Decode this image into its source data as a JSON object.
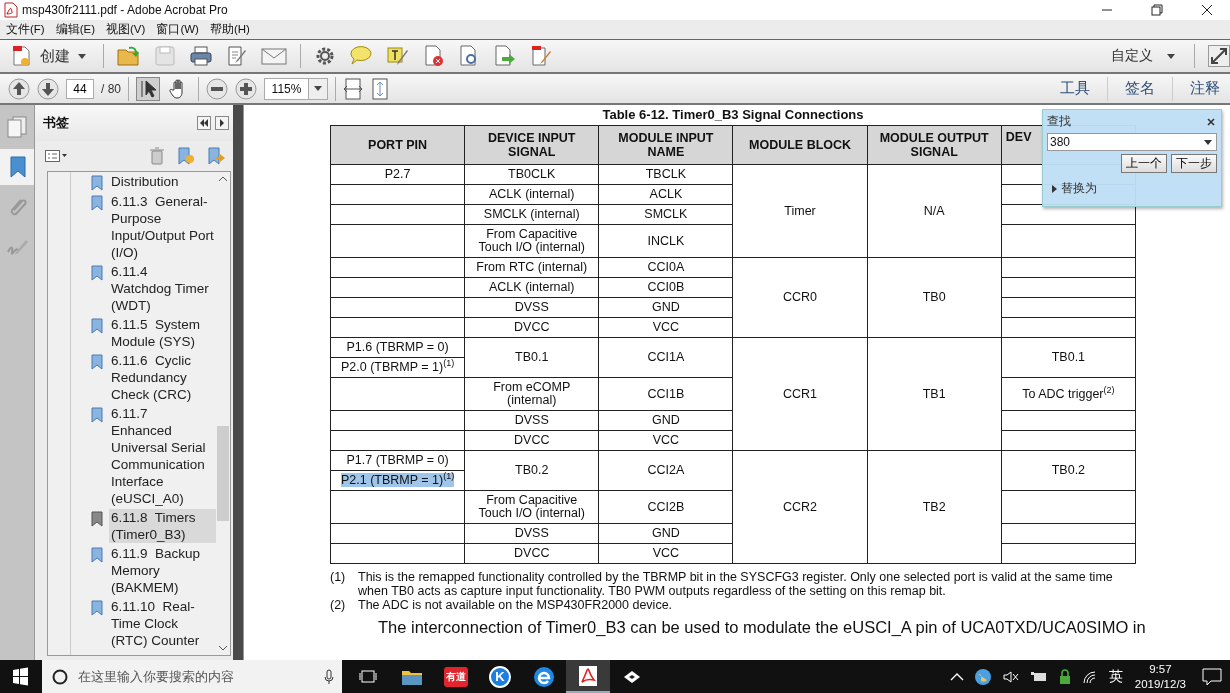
{
  "window": {
    "title": "msp430fr2111.pdf - Adobe Acrobat Pro"
  },
  "menu": [
    "文件(F)",
    "编辑(E)",
    "视图(V)",
    "窗口(W)",
    "帮助(H)"
  ],
  "toolbar": {
    "create_label": "创建",
    "save_disabled": true,
    "customize_label": "自定义"
  },
  "nav_toolbar": {
    "page": "44",
    "page_count": "/ 80",
    "select_tool_selected": true,
    "hand_tool_selected": false,
    "zoom": "115%"
  },
  "panes": [
    "工具",
    "签名",
    "注释"
  ],
  "sidebar": {
    "title": "书签",
    "bookmarks": [
      {
        "label": "Distribution",
        "selected": false
      },
      {
        "label": "6.11.3  General-Purpose Input/Output Port (I/O)",
        "selected": false
      },
      {
        "label": "6.11.4  Watchdog Timer (WDT)",
        "selected": false
      },
      {
        "label": "6.11.5  System Module (SYS)",
        "selected": false
      },
      {
        "label": "6.11.6  Cyclic Redundancy Check (CRC)",
        "selected": false
      },
      {
        "label": "6.11.7  Enhanced Universal Serial Communication Interface (eUSCI_A0)",
        "selected": false
      },
      {
        "label": "6.11.8  Timers (Timer0_B3)",
        "selected": true
      },
      {
        "label": "6.11.9  Backup Memory (BAKMEM)",
        "selected": false
      },
      {
        "label": "6.11.10  Real-Time Clock (RTC) Counter",
        "selected": false
      }
    ]
  },
  "document": {
    "table_title": "Table 6-12. Timer0_B3 Signal Connections",
    "table": {
      "columns": [
        "PORT PIN",
        "DEVICE INPUT SIGNAL",
        "MODULE INPUT NAME",
        "MODULE BLOCK",
        "MODULE OUTPUT SIGNAL",
        "DEV"
      ],
      "groups": [
        {
          "module_block": "Timer",
          "module_output": "N/A",
          "rows": [
            {
              "port_pins": [
                {
                  "text": "P2.7",
                  "highlighted": false
                }
              ],
              "device_input": "TB0CLK",
              "module_input": "TBCLK"
            },
            {
              "device_input": "ACLK (internal)",
              "module_input": "ACLK"
            },
            {
              "device_input": "SMCLK (internal)",
              "module_input": "SMCLK"
            },
            {
              "device_input": "From Capacitive Touch I/O (internal)",
              "module_input": "INCLK"
            }
          ]
        },
        {
          "module_block": "CCR0",
          "module_output": "TB0",
          "rows": [
            {
              "device_input": "From RTC (internal)",
              "module_input": "CCI0A"
            },
            {
              "device_input": "ACLK (internal)",
              "module_input": "CCI0B"
            },
            {
              "device_input": "DVSS",
              "module_input": "GND"
            },
            {
              "device_input": "DVCC",
              "module_input": "VCC"
            }
          ]
        },
        {
          "module_block": "CCR1",
          "module_output": "TB1",
          "rows": [
            {
              "port_pins": [
                {
                  "text": "P1.6 (TBRMP = 0)",
                  "highlighted": false
                },
                {
                  "text": "P2.0 (TBRMP = 1)$^{(1)}$",
                  "highlighted": false
                }
              ],
              "device_input": "TB0.1",
              "module_input": "CCI1A",
              "device_output": "TB0.1"
            },
            {
              "device_input": "From eCOMP (internal)",
              "module_input": "CCI1B",
              "device_output": "To ADC trigger$^{(2)}$"
            },
            {
              "device_input": "DVSS",
              "module_input": "GND"
            },
            {
              "device_input": "DVCC",
              "module_input": "VCC"
            }
          ]
        },
        {
          "module_block": "CCR2",
          "module_output": "TB2",
          "rows": [
            {
              "port_pins": [
                {
                  "text": "P1.7 (TBRMP = 0)",
                  "highlighted": false
                },
                {
                  "text": "P2.1 (TBRMP = 1)$^{(1)}$",
                  "highlighted": true
                }
              ],
              "device_input": "TB0.2",
              "module_input": "CCI2A",
              "device_output": "TB0.2"
            },
            {
              "device_input": "From Capacitive Touch I/O (internal)",
              "module_input": "CCI2B"
            },
            {
              "device_input": "DVSS",
              "module_input": "GND"
            },
            {
              "device_input": "DVCC",
              "module_input": "VCC"
            }
          ]
        }
      ]
    },
    "footnotes": [
      {
        "mark": "(1)",
        "text": "This is the remapped functionality controlled by the TBRMP bit in the SYSCFG3 register. Only one selected port is valid at the same time when TB0 acts as capture input functionality. TB0 PWM outputs regardless of the setting on this remap bit."
      },
      {
        "mark": "(2)",
        "text": "The ADC is not available on the MSP430FR2000 device."
      }
    ],
    "paragraph": "The interconnection of Timer0_B3 can be used to modulate the eUSCI_A pin of UCA0TXD/UCA0SIMO in"
  },
  "find_dialog": {
    "title": "查找",
    "query": "380",
    "buttons": [
      "上一个",
      "下一步"
    ],
    "replace": {
      "label": "替换为",
      "expanded": false
    }
  },
  "taskbar": {
    "search_placeholder": "在这里输入你要搜索的内容",
    "apps": [
      {
        "kind": "folder",
        "active": false
      },
      {
        "kind": "badge",
        "label": "有道",
        "color": "#e0262c",
        "active": false
      },
      {
        "kind": "circle",
        "label": "K",
        "color": "#1e7ee0",
        "active": false
      },
      {
        "kind": "browser",
        "active": false
      },
      {
        "kind": "pdf",
        "active": true
      },
      {
        "kind": "app",
        "active": false
      }
    ],
    "input_language": "英",
    "time": "9:57",
    "date": "2019/12/3"
  }
}
